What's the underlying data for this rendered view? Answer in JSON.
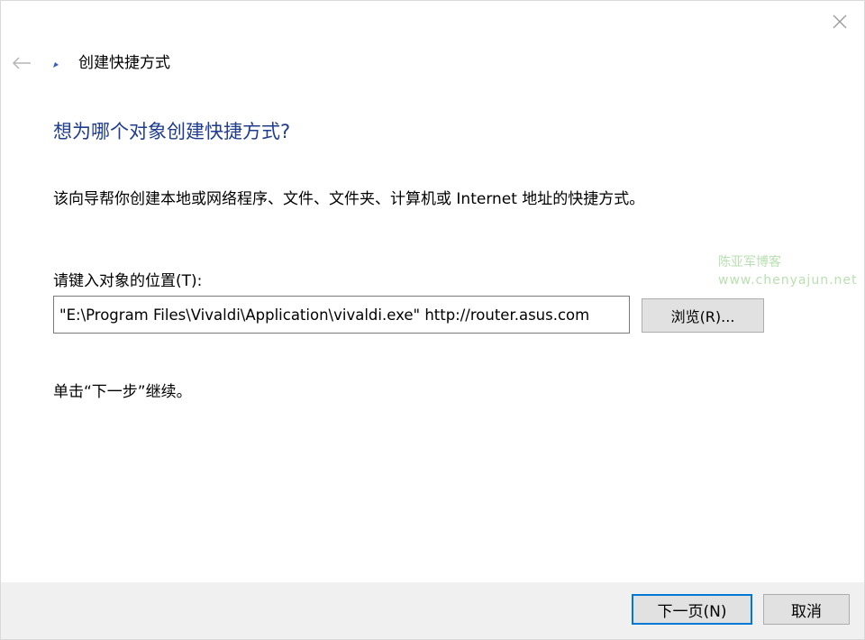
{
  "window": {
    "title": "创建快捷方式"
  },
  "icons": {
    "close": "close-icon",
    "back": "back-arrow-icon",
    "title": "shortcut-icon"
  },
  "main": {
    "heading": "想为哪个对象创建快捷方式?",
    "description": "该向导帮你创建本地或网络程序、文件、文件夹、计算机或 Internet 地址的快捷方式。",
    "field_label": "请键入对象的位置(T):",
    "location_value": "\"E:\\Program Files\\Vivaldi\\Application\\vivaldi.exe\" http://router.asus.com",
    "browse_label": "浏览(R)...",
    "hint": "单击“下一步”继续。"
  },
  "watermark": {
    "line1": "陈亚军博客",
    "line2": "www.chenyajun.net"
  },
  "footer": {
    "next_label": "下一页(N)",
    "cancel_label": "取消"
  },
  "colors": {
    "heading": "#1f3c8f",
    "accent": "#0078d7",
    "footer_bg": "#f0f0f0",
    "watermark": "#b9e0b0"
  }
}
